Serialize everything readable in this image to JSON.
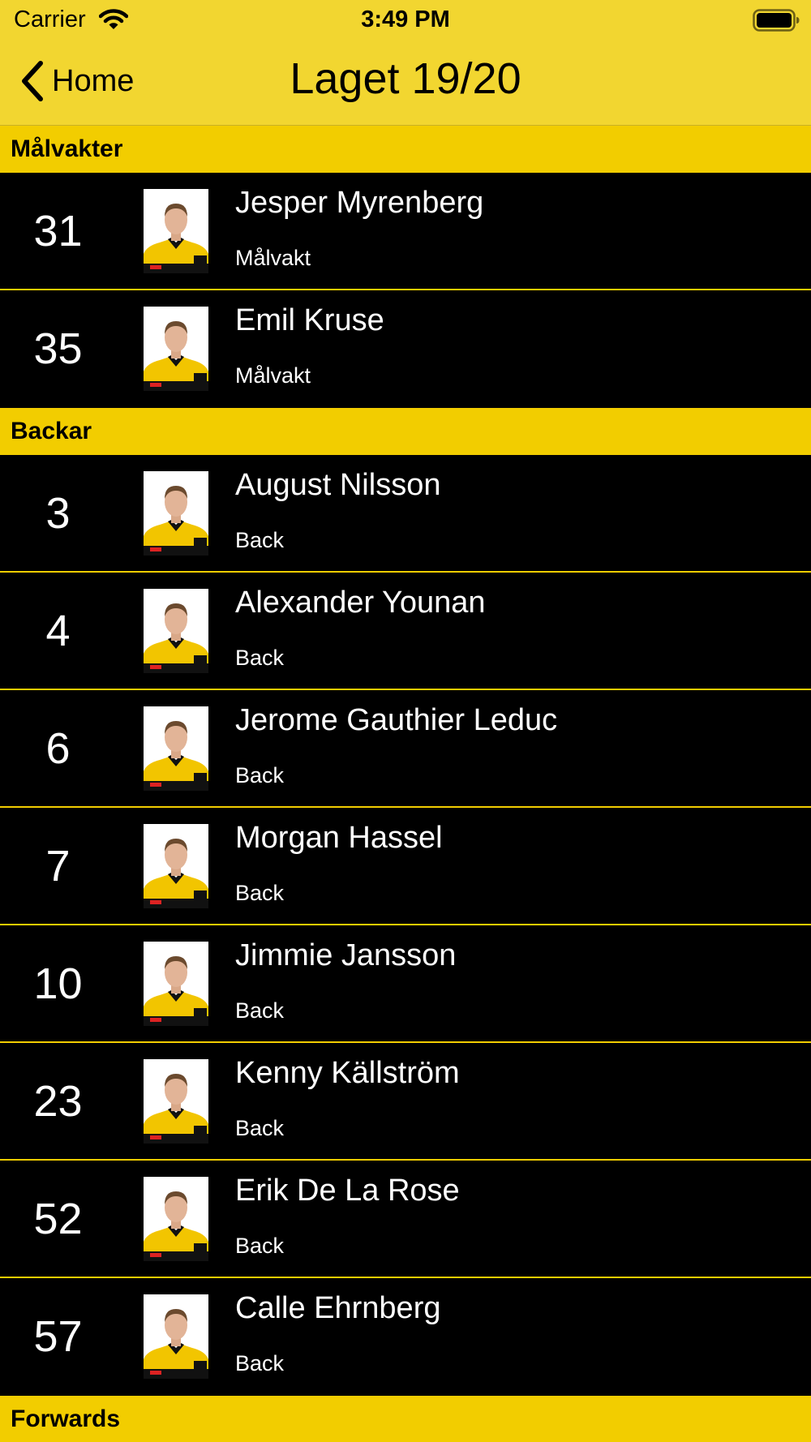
{
  "status_bar": {
    "carrier": "Carrier",
    "time": "3:49 PM"
  },
  "nav": {
    "back_label": "Home",
    "title": "Laget 19/20"
  },
  "colors": {
    "accent_yellow": "#f2cd00",
    "bar_yellow": "#f2d630",
    "row_background": "#000000",
    "text_light": "#ffffff"
  },
  "sections": [
    {
      "title": "Målvakter",
      "players": [
        {
          "number": "31",
          "name": "Jesper Myrenberg",
          "position": "Målvakt"
        },
        {
          "number": "35",
          "name": "Emil Kruse",
          "position": "Målvakt"
        }
      ]
    },
    {
      "title": "Backar",
      "players": [
        {
          "number": "3",
          "name": "August Nilsson",
          "position": "Back"
        },
        {
          "number": "4",
          "name": "Alexander Younan",
          "position": "Back"
        },
        {
          "number": "6",
          "name": "Jerome Gauthier Leduc",
          "position": "Back"
        },
        {
          "number": "7",
          "name": "Morgan Hassel",
          "position": "Back"
        },
        {
          "number": "10",
          "name": "Jimmie Jansson",
          "position": "Back"
        },
        {
          "number": "23",
          "name": "Kenny Källström",
          "position": "Back"
        },
        {
          "number": "52",
          "name": "Erik De La Rose",
          "position": "Back"
        },
        {
          "number": "57",
          "name": "Calle Ehrnberg",
          "position": "Back"
        }
      ]
    },
    {
      "title": "Forwards",
      "players": []
    }
  ]
}
